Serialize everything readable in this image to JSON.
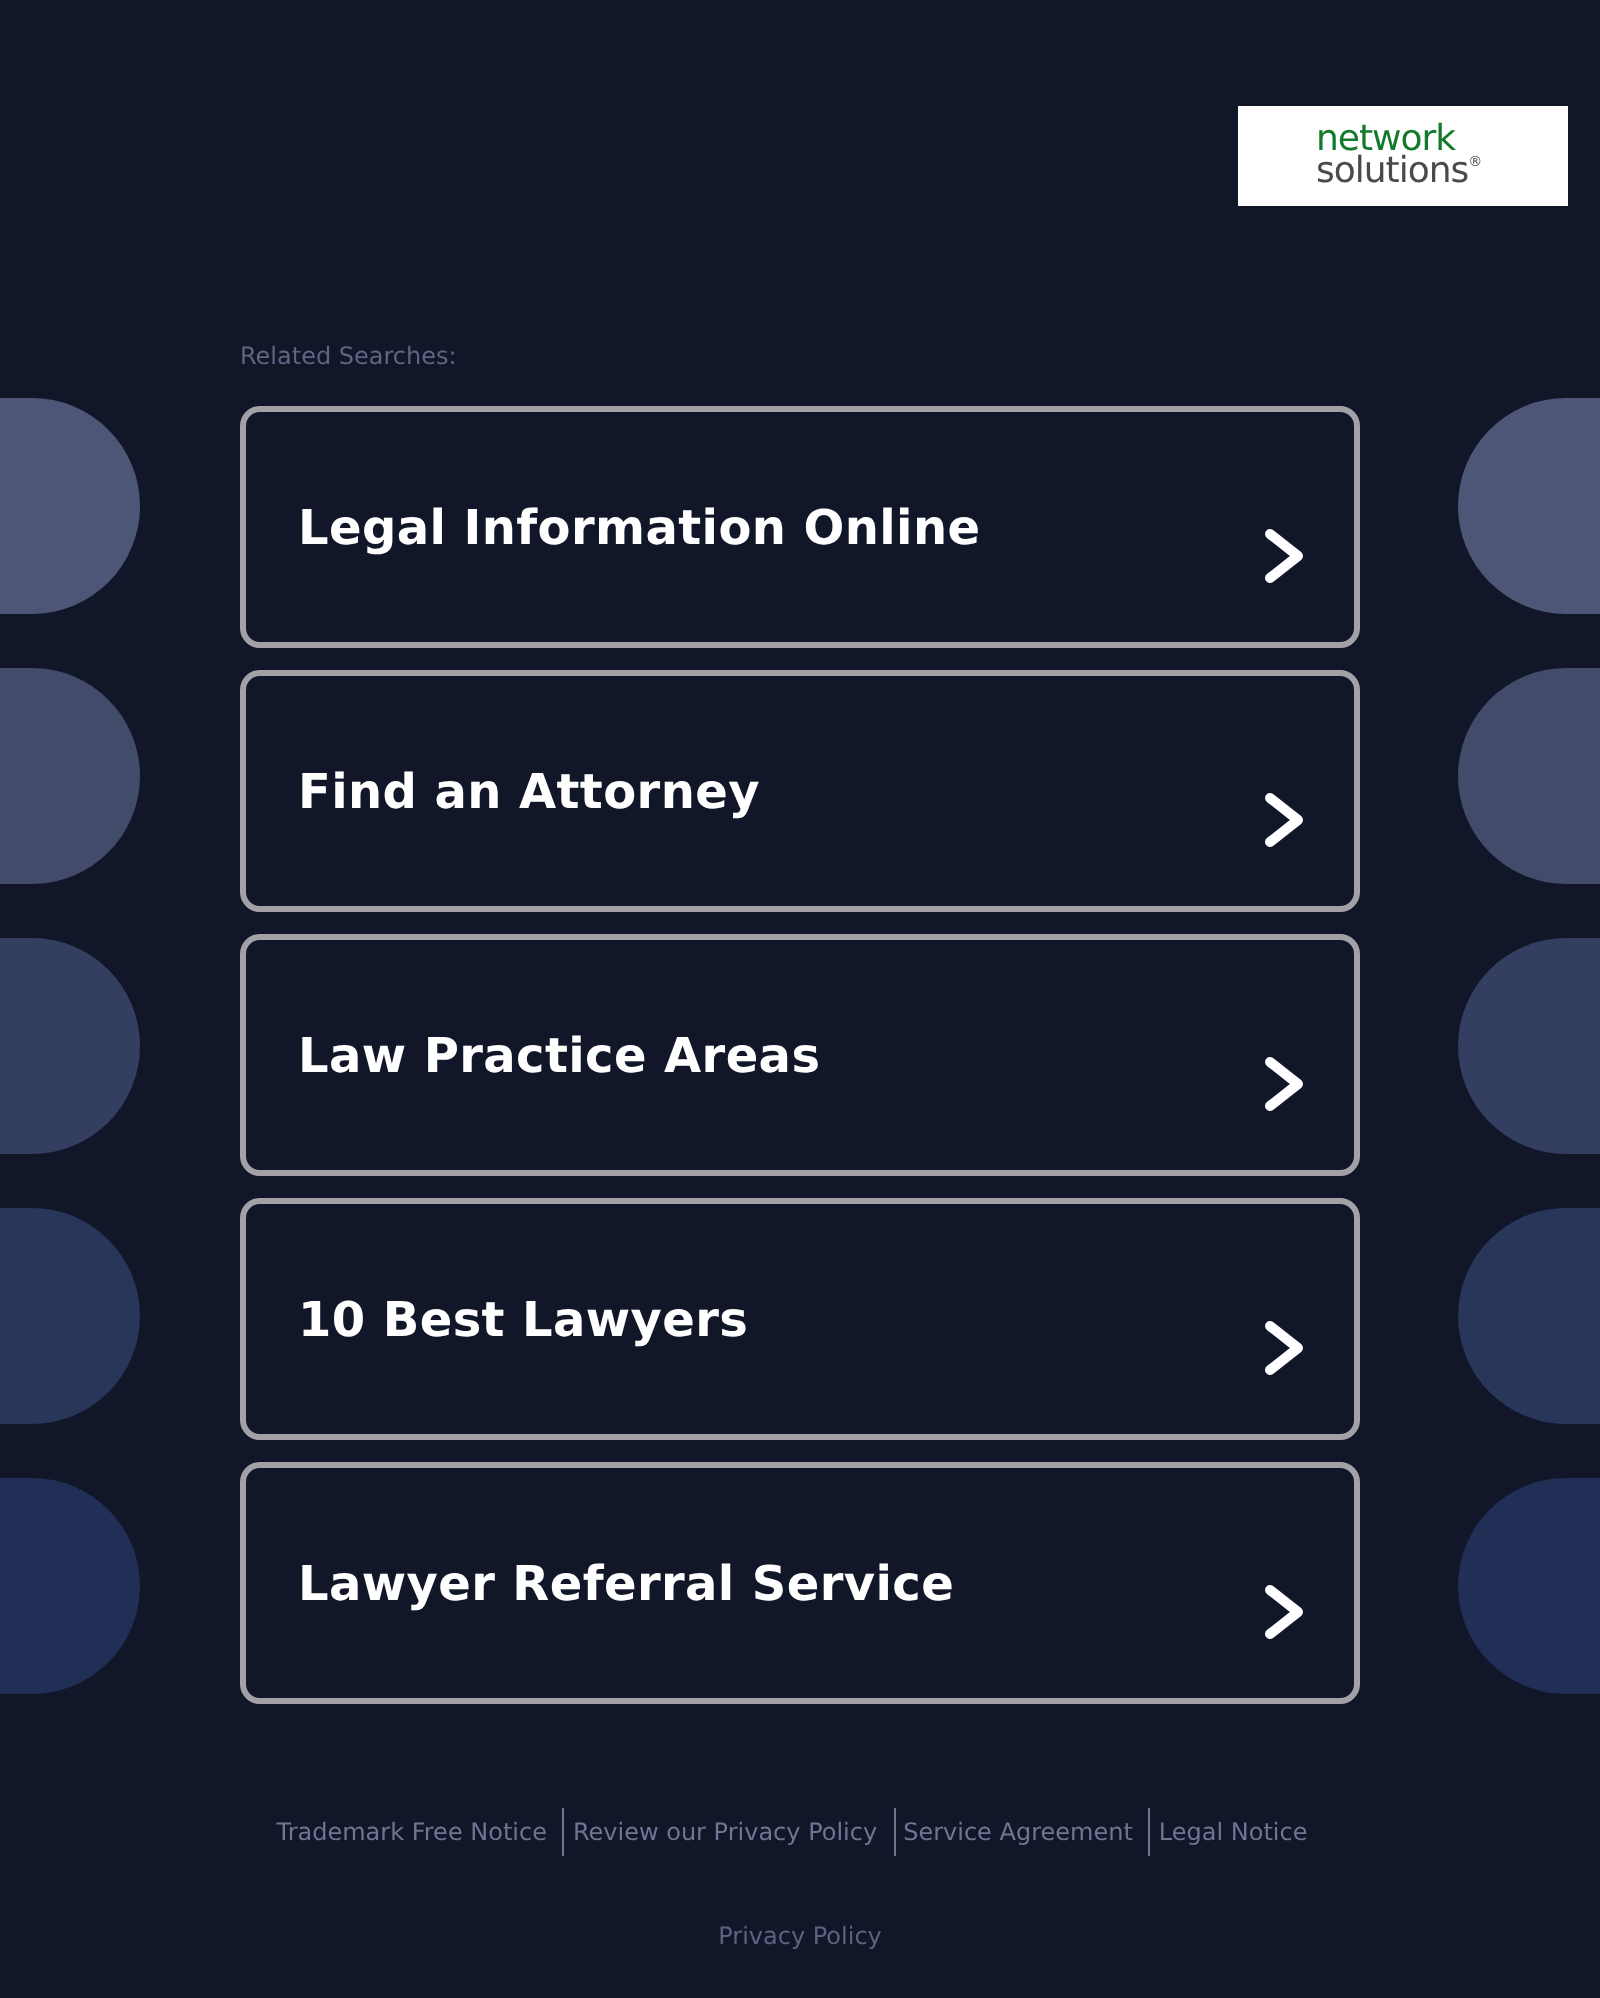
{
  "logo": {
    "line_1": "network",
    "line_2": "solutions$^{®}$"
  },
  "related_searches": {
    "heading": "Related Searches:",
    "links": [
      "Legal Information Online",
      "Find an Attorney",
      "Law Practice Areas",
      "10 Best Lawyers",
      "Lawyer Referral Service"
    ]
  },
  "footer": {
    "links": [
      "Trademark Free Notice",
      "Review our Privacy Policy",
      "Service Agreement",
      "Legal Notice"
    ],
    "privacy_link": "Privacy Policy"
  }
}
